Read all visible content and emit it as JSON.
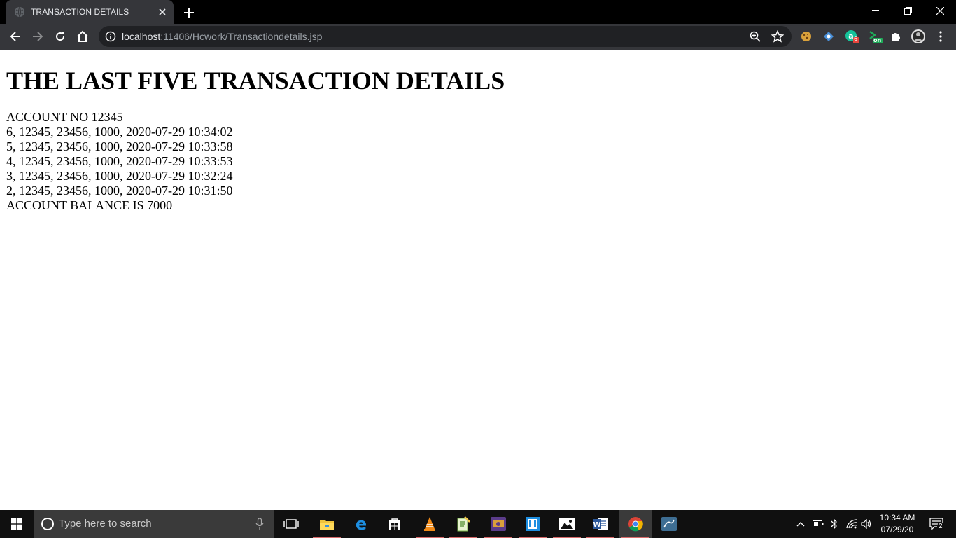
{
  "browser": {
    "tab_title": "TRANSACTION DETAILS",
    "url_host": "localhost",
    "url_path": ":11406/Hcwork/Transactiondetails.jsp",
    "extension_badge_count": "6",
    "extension_on_label": "on"
  },
  "page": {
    "heading": "THE LAST FIVE TRANSACTION DETAILS",
    "account_line": "ACCOUNT NO 12345",
    "transactions": [
      "6, 12345, 23456, 1000, 2020-07-29 10:34:02",
      "5, 12345, 23456, 1000, 2020-07-29 10:33:58",
      "4, 12345, 23456, 1000, 2020-07-29 10:33:53",
      "3, 12345, 23456, 1000, 2020-07-29 10:32:24",
      "2, 12345, 23456, 1000, 2020-07-29 10:31:50"
    ],
    "balance_line": "ACCOUNT BALANCE IS 7000"
  },
  "taskbar": {
    "search_placeholder": "Type here to search",
    "time": "10:34 AM",
    "date": "07/29/20",
    "notification_count": "2",
    "apps": [
      "task-view",
      "file-explorer",
      "edge",
      "store",
      "vlc",
      "editor",
      "media",
      "app",
      "photos",
      "word",
      "chrome",
      "mysql-workbench"
    ]
  },
  "colors": {
    "titlebar": "#000000",
    "toolbar": "#35363a",
    "omnibox": "#202124",
    "taskbar": "#101010"
  }
}
